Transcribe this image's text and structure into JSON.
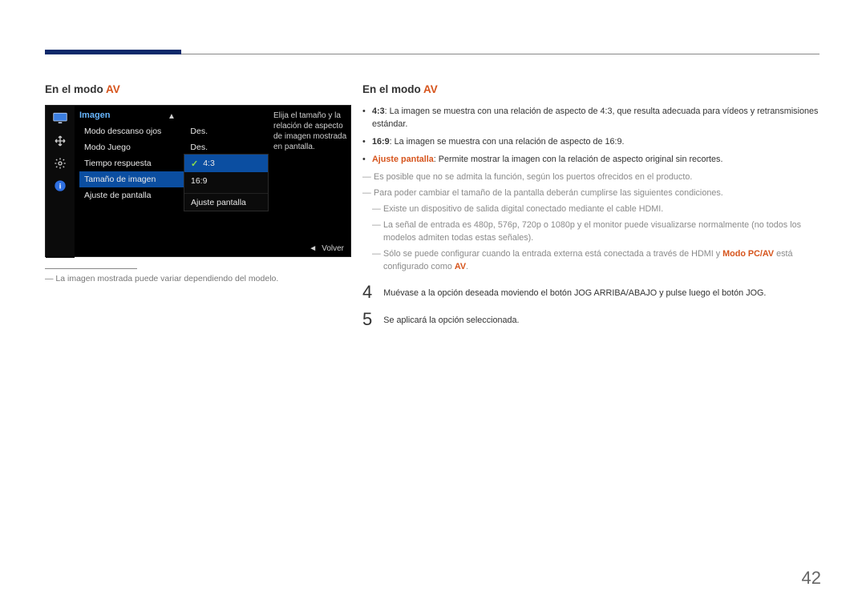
{
  "header_bar_color": "#0e2a6b",
  "left": {
    "heading_prefix": "En el modo ",
    "heading_av": "AV",
    "osd": {
      "title": "Imagen",
      "rows": [
        {
          "label": "Modo descanso ojos",
          "value": "Des."
        },
        {
          "label": "Modo Juego",
          "value": "Des."
        },
        {
          "label": "Tiempo respuesta",
          "value": ""
        },
        {
          "label": "Tamaño de imagen",
          "value": "",
          "selected": true
        },
        {
          "label": "Ajuste de pantalla",
          "value": ""
        }
      ],
      "sub_options": [
        {
          "label": "4:3",
          "checked": true
        },
        {
          "label": "16:9",
          "checked": false
        },
        {
          "label": "Ajuste pantalla",
          "checked": false
        }
      ],
      "help_text": "Elija el tamaño y la relación de aspecto de imagen mostrada en pantalla.",
      "volver": "Volver",
      "icons": [
        "monitor",
        "move",
        "gear",
        "info"
      ]
    },
    "footnote": "La imagen mostrada puede variar dependiendo del modelo."
  },
  "right": {
    "heading_prefix": "En el modo ",
    "heading_av": "AV",
    "bullets": [
      {
        "label": "4:3",
        "text": ": La imagen se muestra con una relación de aspecto de 4:3, que resulta adecuada para vídeos y retransmisiones estándar."
      },
      {
        "label": "16:9",
        "text": ": La imagen se muestra con una relación de aspecto de 16:9."
      },
      {
        "label": "Ajuste pantalla",
        "text": ": Permite mostrar la imagen con la relación de aspecto original sin recortes."
      }
    ],
    "notes": [
      "Es posible que no se admita la función, según los puertos ofrecidos en el producto.",
      "Para poder cambiar el tamaño de la pantalla deberán cumplirse las siguientes condiciones."
    ],
    "subnotes": [
      "Existe un dispositivo de salida digital conectado mediante el cable HDMI.",
      "La señal de entrada es 480p, 576p, 720p o 1080p y el monitor puede visualizarse normalmente (no todos los modelos admiten todas estas señales).",
      {
        "pre": "Sólo se puede configurar cuando la entrada externa está conectada a través de HDMI y ",
        "orange": "Modo PC/AV",
        "mid": " está configurado como ",
        "orange2": "AV",
        "suf": "."
      }
    ],
    "steps": [
      {
        "num": "4",
        "text": "Muévase a la opción deseada moviendo el botón JOG ARRIBA/ABAJO y pulse luego el botón JOG."
      },
      {
        "num": "5",
        "text": "Se aplicará la opción seleccionada."
      }
    ]
  },
  "page_number": "42"
}
